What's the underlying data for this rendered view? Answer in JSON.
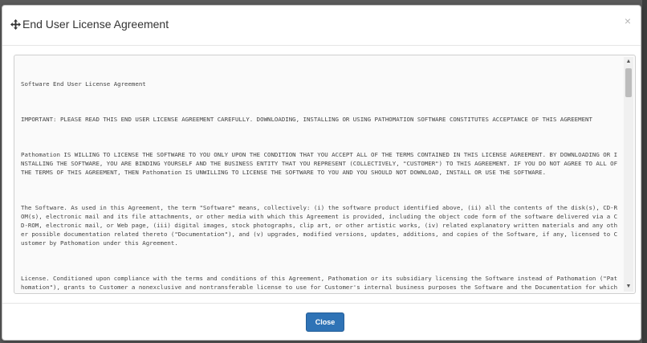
{
  "dialog": {
    "title": "End User License Agreement",
    "close_x": "×",
    "move_icon": "move-icon"
  },
  "license": {
    "paragraphs": [
      "Software End User License Agreement",
      "IMPORTANT: PLEASE READ THIS END USER LICENSE AGREEMENT CAREFULLY. DOWNLOADING, INSTALLING OR USING PATHOMATION SOFTWARE CONSTITUTES ACCEPTANCE OF THIS AGREEMENT",
      "Pathomation IS WILLING TO LICENSE THE SOFTWARE TO YOU ONLY UPON THE CONDITION THAT YOU ACCEPT ALL OF THE TERMS CONTAINED IN THIS LICENSE AGREEMENT. BY DOWNLOADING OR INSTALLING THE SOFTWARE, YOU ARE BINDING YOURSELF AND THE BUSINESS ENTITY THAT YOU REPRESENT (COLLECTIVELY, \"CUSTOMER\") TO THIS AGREEMENT. IF YOU DO NOT AGREE TO ALL OF THE TERMS OF THIS AGREEMENT, THEN Pathomation IS UNWILLING TO LICENSE THE SOFTWARE TO YOU AND YOU SHOULD NOT DOWNLOAD, INSTALL OR USE THE SOFTWARE.",
      "The Software. As used in this Agreement, the term \"Software\" means, collectively: (i) the software product identified above, (ii) all the contents of the disk(s), CD-ROM(s), electronic mail and its file attachments, or other media with which this Agreement is provided, including the object code form of the software delivered via a CD-ROM, electronic mail, or Web page, (iii) digital images, stock photographs, clip art, or other artistic works, (iv) related explanatory written materials and any other possible documentation related thereto (\"Documentation\"), and (v) upgrades, modified versions, updates, additions, and copies of the Software, if any, licensed to Customer by Pathomation under this Agreement.",
      "License. Conditioned upon compliance with the terms and conditions of this Agreement, Pathomation or its subsidiary licensing the Software instead of Pathomation (\"Pathomation\"), grants to Customer a nonexclusive and nontransferable license to use for Customer's internal business purposes the Software and the Documentation for which Customer has paid the required license fees. \"Documentation\" means written information (whether contained in user or technical manuals, training materials, specifications or otherwise) specifically pertaining to the Software and made available by Pathomation with the Software in any manner."
    ]
  },
  "scrollbar": {
    "up_arrow": "▲",
    "down_arrow": "▼"
  },
  "footer": {
    "close_label": "Close"
  },
  "colors": {
    "primary_button": "#2f73b6",
    "backdrop": "#5a5a5a"
  }
}
